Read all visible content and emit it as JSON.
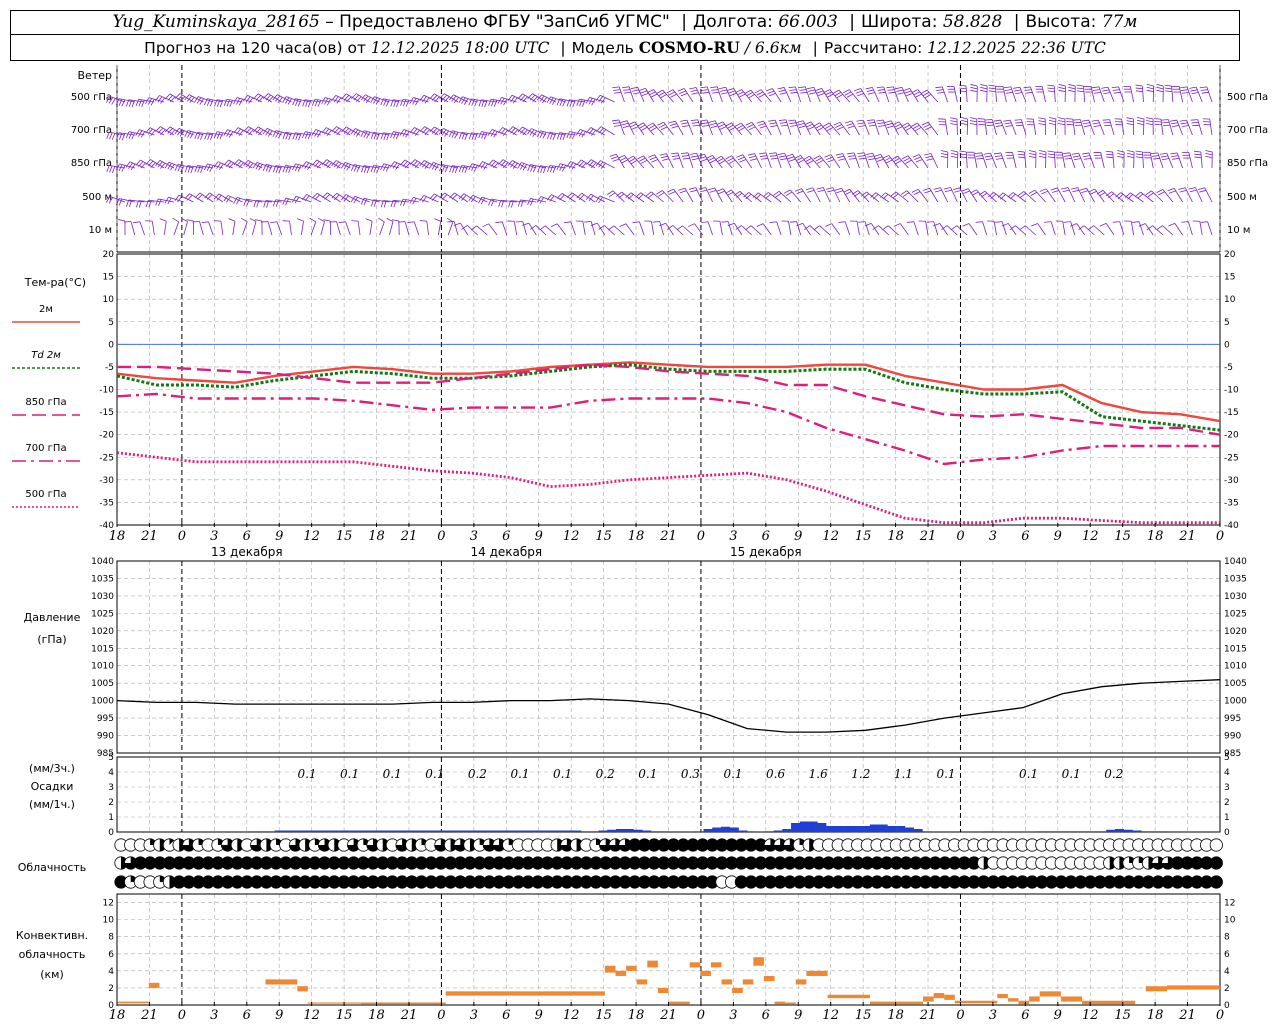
{
  "header": {
    "station": "Yug_Kuminskaya_28165",
    "provider": "– Предоставлено ФГБУ \"ЗапСиб УГМС\"",
    "lon_label": "Долгота:",
    "lon": "66.003",
    "lat_label": "Широта:",
    "lat": "58.828",
    "alt_label": "Высота:",
    "alt": "77м",
    "forecast_label": "Прогноз на 120 часа(ов) от",
    "forecast_time": "12.12.2025 18:00 UTC",
    "model_label": "Модель",
    "model": "COSMO-RU",
    "model_res": "/ 6.6км",
    "calc_label": "Рассчитано:",
    "calc_time": "12.12.2025 22:36 UTC"
  },
  "colors": {
    "wind": "#7a1fc9",
    "t2m": "#f0463c",
    "td2m": "#0f7a0f",
    "upper": "#e01c7c",
    "zero_line": "#3355ee",
    "pressure": "#000000",
    "precip": "#1f3fd6",
    "convective": "#ee8833"
  },
  "panel_labels": {
    "wind_title": "Ветер",
    "temp_title": "Тем-ра(°C)",
    "pressure_title": [
      "Давление",
      "(гПа)"
    ],
    "precip_title": [
      "(мм/3ч.)",
      "Осадки",
      "(мм/1ч.)"
    ],
    "cloud_title": "Облачность",
    "conv_title": [
      "Конвективн.",
      "облачность",
      "(км)"
    ]
  },
  "chart_data": [
    {
      "type": "wind_barbs",
      "levels": [
        "500 гПа",
        "700 гПа",
        "850 гПа",
        "500 м",
        "10 м"
      ],
      "interval_hours": 1
    },
    {
      "type": "line",
      "x_ticks": [
        "18",
        "21",
        "0",
        "3",
        "6",
        "9",
        "12",
        "15",
        "18",
        "21",
        "0",
        "3",
        "6",
        "9",
        "12",
        "15",
        "18",
        "21",
        "0",
        "3",
        "6",
        "9",
        "12",
        "15",
        "18",
        "21",
        "0",
        "3",
        "6",
        "9",
        "12",
        "15",
        "18",
        "21",
        "0"
      ],
      "dates": [
        {
          "at_tick": 4,
          "label": "13 декабря"
        },
        {
          "at_tick": 12,
          "label": "14 декабря"
        },
        {
          "at_tick": 20,
          "label": "15 декабря"
        }
      ],
      "ylim": [
        -40,
        20
      ],
      "y_ticks": [
        20,
        15,
        10,
        5,
        0,
        -5,
        -10,
        -15,
        -20,
        -25,
        -30,
        -35,
        -40
      ],
      "grid": true,
      "series": [
        {
          "name": "2м",
          "style": "solid",
          "values": [
            -6.5,
            -7.5,
            -8,
            -8.5,
            -7,
            -6,
            -5,
            -5.5,
            -6.5,
            -6.5,
            -6,
            -5,
            -4.5,
            -4,
            -4.5,
            -5,
            -5,
            -5,
            -4.5,
            -4.5,
            -7,
            -8.5,
            -10,
            -10,
            -9,
            -13,
            -15,
            -15.5,
            -17
          ]
        },
        {
          "name": "Td 2м",
          "style": "dotted",
          "values": [
            -7,
            -9,
            -9,
            -9.5,
            -8,
            -7,
            -6,
            -6.5,
            -7.5,
            -7.5,
            -7,
            -6,
            -5,
            -4.5,
            -5.5,
            -6,
            -6,
            -6,
            -5.5,
            -5.5,
            -8.5,
            -10,
            -11,
            -11,
            -10.5,
            -16,
            -17,
            -18,
            -19
          ]
        },
        {
          "name": "850 гПа",
          "style": "dash",
          "values": [
            -5,
            -5,
            -5.5,
            -6,
            -6.5,
            -7.5,
            -8.5,
            -8.5,
            -8.5,
            -7.5,
            -6.5,
            -5.5,
            -4.5,
            -5,
            -6,
            -6.5,
            -7,
            -9,
            -9,
            -11.5,
            -13.5,
            -15.5,
            -16,
            -15.5,
            -16.5,
            -17.5,
            -18.5,
            -18.5,
            -20
          ]
        },
        {
          "name": "700 гПа",
          "style": "dashdot",
          "values": [
            -11.5,
            -11,
            -12,
            -12,
            -12,
            -12,
            -12.5,
            -13.5,
            -14.5,
            -14,
            -14,
            -14,
            -12.5,
            -12,
            -12,
            -12,
            -13,
            -15,
            -18.5,
            -21,
            -23.5,
            -26.5,
            -25.5,
            -25,
            -23.5,
            -22.5,
            -22.5,
            -22.5,
            -22.5
          ]
        },
        {
          "name": "500 гПа",
          "style": "dotted-fine",
          "values": [
            -24,
            -25,
            -26,
            -26,
            -26,
            -26,
            -26,
            -27,
            -28,
            -28.5,
            -29.5,
            -31.5,
            -31,
            -30,
            -29.5,
            -29,
            -28.5,
            -30,
            -32.5,
            -35.5,
            -38.5,
            -39.5,
            -39.5,
            -38.5,
            -38.5,
            -39,
            -39.5,
            -39.5,
            -39.5
          ]
        }
      ]
    },
    {
      "type": "line",
      "ylim": [
        985,
        1040
      ],
      "y_ticks": [
        1040,
        1035,
        1030,
        1025,
        1020,
        1015,
        1010,
        1005,
        1000,
        995,
        990,
        985
      ],
      "grid": true,
      "values": [
        1000,
        999.5,
        999.5,
        999,
        999,
        999,
        999,
        999,
        999.5,
        999.5,
        1000,
        1000,
        1000.5,
        1000,
        999,
        996,
        992,
        991,
        991,
        991.5,
        993,
        995,
        996.5,
        998,
        1002,
        1004,
        1005,
        1005.5,
        1006
      ]
    },
    {
      "type": "bar",
      "ylim": [
        0,
        5
      ],
      "y_ticks": [
        5,
        4,
        3,
        2,
        1,
        0
      ],
      "labels_3h": [
        "0.1",
        "0.1",
        "0.1",
        "0.1",
        "0.2",
        "0.1",
        "0.1",
        "0.2",
        "0.1",
        "0.3",
        "0.1",
        "0.6",
        "1.6",
        "1.2",
        "1.1",
        "0.1",
        "0.1",
        "0.1",
        "0.2"
      ],
      "values_1h": [
        0,
        0,
        0,
        0,
        0,
        0,
        0,
        0,
        0,
        0,
        0,
        0,
        0,
        0,
        0,
        0.05,
        0.05,
        0.05,
        0.1,
        0.1,
        0.1,
        0.1,
        0.1,
        0.1,
        0.1,
        0.1,
        0.1,
        0.1,
        0.1,
        0.1,
        0.1,
        0.1,
        0.1,
        0.1,
        0.1,
        0.1,
        0.1,
        0.1,
        0.1,
        0.1,
        0.1,
        0.1,
        0.1,
        0.1,
        0.1,
        0.1,
        0.1,
        0.1,
        0.1,
        0.1,
        0.1,
        0.1,
        0.1,
        0.05,
        0.05,
        0.1,
        0.15,
        0.2,
        0.2,
        0.15,
        0.1,
        0.05,
        0.05,
        0,
        0,
        0,
        0.05,
        0.2,
        0.3,
        0.35,
        0.3,
        0.1,
        0.05,
        0,
        0.05,
        0.1,
        0.2,
        0.6,
        0.7,
        0.7,
        0.6,
        0.4,
        0.4,
        0.4,
        0.4,
        0.4,
        0.5,
        0.5,
        0.4,
        0.4,
        0.3,
        0.2,
        0.05,
        0,
        0,
        0,
        0,
        0,
        0,
        0.05,
        0.05,
        0,
        0,
        0,
        0,
        0.05,
        0.05,
        0.05,
        0.05,
        0.05,
        0.05,
        0.05,
        0.05,
        0.15,
        0.2,
        0.15,
        0.1,
        0.05,
        0.05,
        0.05,
        0,
        0,
        0,
        0,
        0,
        0
      ]
    },
    {
      "type": "cloud_cover",
      "levels": [
        "high",
        "middle",
        "low"
      ],
      "scale": "octas",
      "high": [
        0,
        0,
        0,
        2,
        4,
        1,
        4,
        6,
        2,
        0,
        2,
        6,
        4,
        0,
        6,
        4,
        2,
        0,
        6,
        4,
        2,
        6,
        4,
        0,
        6,
        2,
        6,
        4,
        0,
        6,
        4,
        2,
        0,
        6,
        4,
        6,
        4,
        2,
        6,
        6,
        2,
        0,
        0,
        0,
        0,
        4,
        6,
        4,
        0,
        2,
        6,
        6,
        6,
        8,
        8,
        8,
        8,
        8,
        8,
        8,
        8,
        8,
        8,
        8,
        8,
        8,
        8,
        6,
        6,
        6,
        2,
        4,
        0,
        0,
        0,
        0,
        0,
        0,
        0,
        0,
        0,
        0,
        0,
        0,
        0,
        0,
        0,
        0,
        0,
        0,
        0,
        0,
        0,
        0,
        0,
        0,
        0,
        0,
        0,
        0,
        0,
        0,
        0,
        0,
        0,
        0,
        0,
        0,
        0,
        0,
        0,
        0,
        0,
        0
      ],
      "middle": [
        4,
        6,
        8,
        8,
        8,
        8,
        8,
        8,
        8,
        8,
        8,
        8,
        8,
        8,
        8,
        8,
        8,
        8,
        8,
        8,
        8,
        8,
        8,
        8,
        8,
        8,
        8,
        8,
        8,
        8,
        8,
        8,
        8,
        8,
        8,
        8,
        8,
        8,
        8,
        8,
        8,
        8,
        8,
        8,
        8,
        8,
        8,
        8,
        8,
        8,
        8,
        8,
        8,
        8,
        8,
        8,
        8,
        8,
        8,
        8,
        8,
        8,
        8,
        8,
        8,
        8,
        8,
        8,
        8,
        8,
        8,
        8,
        8,
        8,
        8,
        8,
        8,
        8,
        8,
        8,
        8,
        8,
        8,
        8,
        8,
        8,
        8,
        8,
        8,
        4,
        0,
        0,
        0,
        0,
        0,
        0,
        0,
        0,
        0,
        0,
        0,
        0,
        4,
        4,
        2,
        2,
        4,
        6,
        6,
        8,
        8,
        8,
        8,
        8
      ],
      "low": [
        8,
        2,
        0,
        0,
        2,
        4,
        8,
        8,
        8,
        8,
        8,
        8,
        8,
        8,
        8,
        8,
        8,
        8,
        8,
        8,
        8,
        8,
        8,
        8,
        8,
        8,
        8,
        8,
        8,
        8,
        8,
        8,
        8,
        8,
        8,
        8,
        8,
        8,
        8,
        8,
        8,
        8,
        8,
        8,
        8,
        8,
        8,
        8,
        8,
        8,
        8,
        8,
        8,
        8,
        8,
        8,
        8,
        8,
        8,
        8,
        8,
        8,
        0,
        0,
        8,
        8,
        8,
        8,
        8,
        8,
        8,
        8,
        8,
        8,
        8,
        8,
        8,
        8,
        8,
        8,
        8,
        8,
        8,
        8,
        8,
        8,
        8,
        8,
        8,
        8,
        8,
        8,
        8,
        8,
        8,
        8,
        8,
        8,
        8,
        8,
        8,
        8,
        8,
        8,
        8,
        8,
        8,
        8,
        8,
        8,
        8,
        8,
        8,
        8
      ]
    },
    {
      "type": "bar",
      "ylim": [
        0,
        13
      ],
      "y_ticks": [
        12,
        10,
        8,
        6,
        4,
        2,
        0
      ],
      "ranges_km": [
        [
          0,
          3,
          0.2,
          0.4
        ],
        [
          3,
          4,
          2.0,
          2.6
        ],
        [
          14,
          17,
          2.4,
          3.0
        ],
        [
          17,
          18,
          1.6,
          2.2
        ],
        [
          18,
          23,
          0.2,
          0.3
        ],
        [
          23,
          31,
          0.1,
          0.3
        ],
        [
          31,
          37,
          1.1,
          1.6
        ],
        [
          37,
          46,
          1.1,
          1.6
        ],
        [
          46,
          47,
          3.8,
          4.6
        ],
        [
          47,
          48,
          3.4,
          4.0
        ],
        [
          48,
          49,
          4.0,
          4.6
        ],
        [
          49,
          50,
          2.4,
          3.0
        ],
        [
          50,
          51,
          4.4,
          5.2
        ],
        [
          51,
          52,
          1.4,
          2.0
        ],
        [
          52,
          54,
          0.1,
          0.4
        ],
        [
          54,
          55,
          4.4,
          5.0
        ],
        [
          55,
          56,
          3.4,
          4.0
        ],
        [
          56,
          57,
          4.4,
          5.0
        ],
        [
          57,
          58,
          2.4,
          3.0
        ],
        [
          58,
          59,
          1.4,
          2.0
        ],
        [
          59,
          60,
          2.4,
          3.0
        ],
        [
          60,
          61,
          4.6,
          5.6
        ],
        [
          61,
          62,
          2.8,
          3.4
        ],
        [
          62,
          63,
          0.1,
          0.4
        ],
        [
          63,
          64,
          0.1,
          0.3
        ],
        [
          64,
          65,
          2.4,
          3.0
        ],
        [
          65,
          67,
          3.4,
          4.0
        ],
        [
          67,
          71,
          0.8,
          1.2
        ],
        [
          71,
          76,
          0.1,
          0.4
        ],
        [
          76,
          77,
          0.4,
          1.0
        ],
        [
          77,
          78,
          0.8,
          1.4
        ],
        [
          78,
          79,
          0.6,
          1.2
        ],
        [
          79,
          83,
          0.2,
          0.5
        ],
        [
          83,
          84,
          0.8,
          1.3
        ],
        [
          84,
          85,
          0.4,
          0.8
        ],
        [
          85,
          86,
          0.1,
          0.5
        ],
        [
          86,
          87,
          0.4,
          1.0
        ],
        [
          87,
          89,
          1.0,
          1.6
        ],
        [
          89,
          91,
          0.4,
          1.0
        ],
        [
          91,
          96,
          0.1,
          0.5
        ],
        [
          97,
          99,
          1.6,
          2.2
        ],
        [
          99,
          104,
          1.8,
          2.3
        ]
      ]
    }
  ]
}
